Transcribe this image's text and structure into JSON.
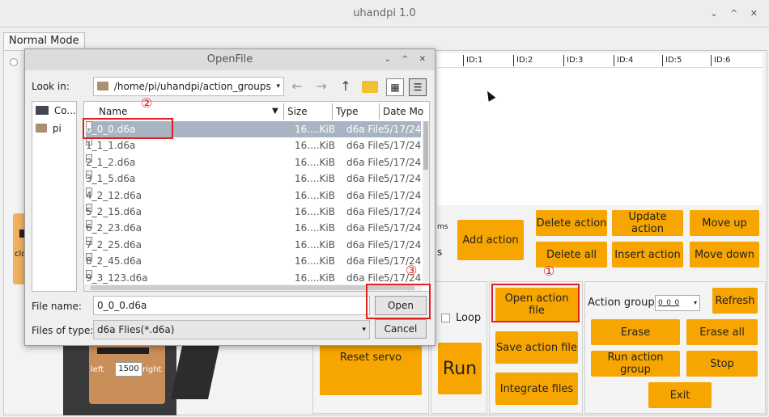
{
  "window": {
    "title": "uhandpi 1.0",
    "controls": "⌄ ^ ✕"
  },
  "tab": {
    "label": "Normal Mode"
  },
  "id_header": [
    "ID:1",
    "ID:2",
    "ID:3",
    "ID:4",
    "ID:5",
    "ID:6"
  ],
  "partial_left": {
    "clo": "clo",
    "ms": "ms",
    "s": "s"
  },
  "action_buttons": {
    "add_action": "Add action",
    "delete_action": "Delete action",
    "update_action": "Update action",
    "move_up": "Move up",
    "delete_all": "Delete all",
    "insert_action": "Insert action",
    "move_down": "Move down"
  },
  "servo": {
    "reset": "Reset servo",
    "left": "left",
    "right": "right",
    "value": "1500"
  },
  "run_group": {
    "loop_label": "Loop",
    "run": "Run"
  },
  "file_buttons": {
    "open_action_file": "Open action file",
    "save_action_file": "Save action file",
    "integrate_files": "Integrate files"
  },
  "action_group_panel": {
    "label": "Action group",
    "selected": "0_0_0",
    "refresh": "Refresh",
    "erase": "Erase",
    "erase_all": "Erase all",
    "run_action_group": "Run action group",
    "stop": "Stop",
    "exit": "Exit"
  },
  "dialog": {
    "title": "OpenFile",
    "look_in_label": "Look in:",
    "look_in_path": "/home/pi/uhandpi/action_groups",
    "sidebar": [
      {
        "label": "Co..."
      },
      {
        "label": "pi"
      }
    ],
    "columns": {
      "name": "Name",
      "size": "Size",
      "type": "Type",
      "date": "Date Mo"
    },
    "files": [
      {
        "name": "0_0_0.d6a",
        "size": "16....KiB",
        "type": "d6a File",
        "date": "5/17/24"
      },
      {
        "name": "1_1_1.d6a",
        "size": "16....KiB",
        "type": "d6a File",
        "date": "5/17/24"
      },
      {
        "name": "2_1_2.d6a",
        "size": "16....KiB",
        "type": "d6a File",
        "date": "5/17/24"
      },
      {
        "name": "3_1_5.d6a",
        "size": "16....KiB",
        "type": "d6a File",
        "date": "5/17/24"
      },
      {
        "name": "4_2_12.d6a",
        "size": "16....KiB",
        "type": "d6a File",
        "date": "5/17/24"
      },
      {
        "name": "5_2_15.d6a",
        "size": "16....KiB",
        "type": "d6a File",
        "date": "5/17/24"
      },
      {
        "name": "6_2_23.d6a",
        "size": "16....KiB",
        "type": "d6a File",
        "date": "5/17/24"
      },
      {
        "name": "7_2_25.d6a",
        "size": "16....KiB",
        "type": "d6a File",
        "date": "5/17/24"
      },
      {
        "name": "8_2_45.d6a",
        "size": "16....KiB",
        "type": "d6a File",
        "date": "5/17/24"
      },
      {
        "name": "9_3_123.d6a",
        "size": "16....KiB",
        "type": "d6a File",
        "date": "5/17/24"
      }
    ],
    "file_name_label": "File name:",
    "file_name_value": "0_0_0.d6a",
    "file_type_label": "Files of type:",
    "file_type_value": "d6a Flies(*.d6a)",
    "open": "Open",
    "cancel": "Cancel"
  },
  "annotations": {
    "one": "①",
    "two": "②",
    "three": "③"
  },
  "colors": {
    "accent": "#f7a500",
    "highlight": "#e0201e",
    "selected_row": "#a9b4c2"
  }
}
